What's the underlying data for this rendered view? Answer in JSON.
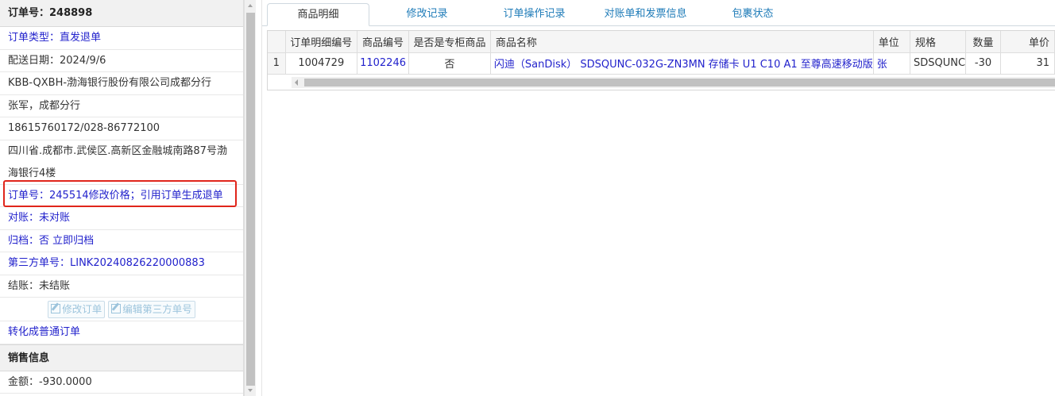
{
  "order_panel": {
    "header": "订单号：248898",
    "rows": [
      "订单类型：直发退单",
      "配送日期：2024/9/6",
      "KBB-QXBH-渤海银行股份有限公司成都分行",
      "张军，成都分行",
      "18615760172/028-86772100",
      "四川省.成都市.武侯区.高新区金融城南路87号渤海银行4楼",
      "订单号：245514修改价格；引用订单生成退单",
      "对账：未对账",
      "归档：否 立即归档",
      "第三方单号：LINK20240826220000883",
      "结账：未结账"
    ],
    "buttons": {
      "edit_order": "修改订单",
      "edit_third_party": "编辑第三方单号"
    },
    "convert_link": "转化成普通订单",
    "sales_header": "销售信息",
    "amount": "金额：-930.0000"
  },
  "tabs": [
    "商品明细",
    "修改记录",
    "订单操作记录",
    "对账单和发票信息",
    "包裹状态"
  ],
  "grid": {
    "columns": [
      "订单明细编号",
      "商品编号",
      "是否是专柜商品",
      "商品名称",
      "单位",
      "规格",
      "数量",
      "单价"
    ],
    "rows": [
      [
        "1",
        "1004729",
        "1102246",
        "否",
        "闪迪（SanDisk） SDSQUNC-032G-ZN3MN 存储卡 U1 C10 A1 至尊高速移动版",
        "张",
        "SDSQUNC",
        "-30",
        "31"
      ]
    ]
  },
  "colors": {
    "link": "#2222cc",
    "tab_link": "#1e7bb8",
    "highlight_border": "#e0251b"
  }
}
